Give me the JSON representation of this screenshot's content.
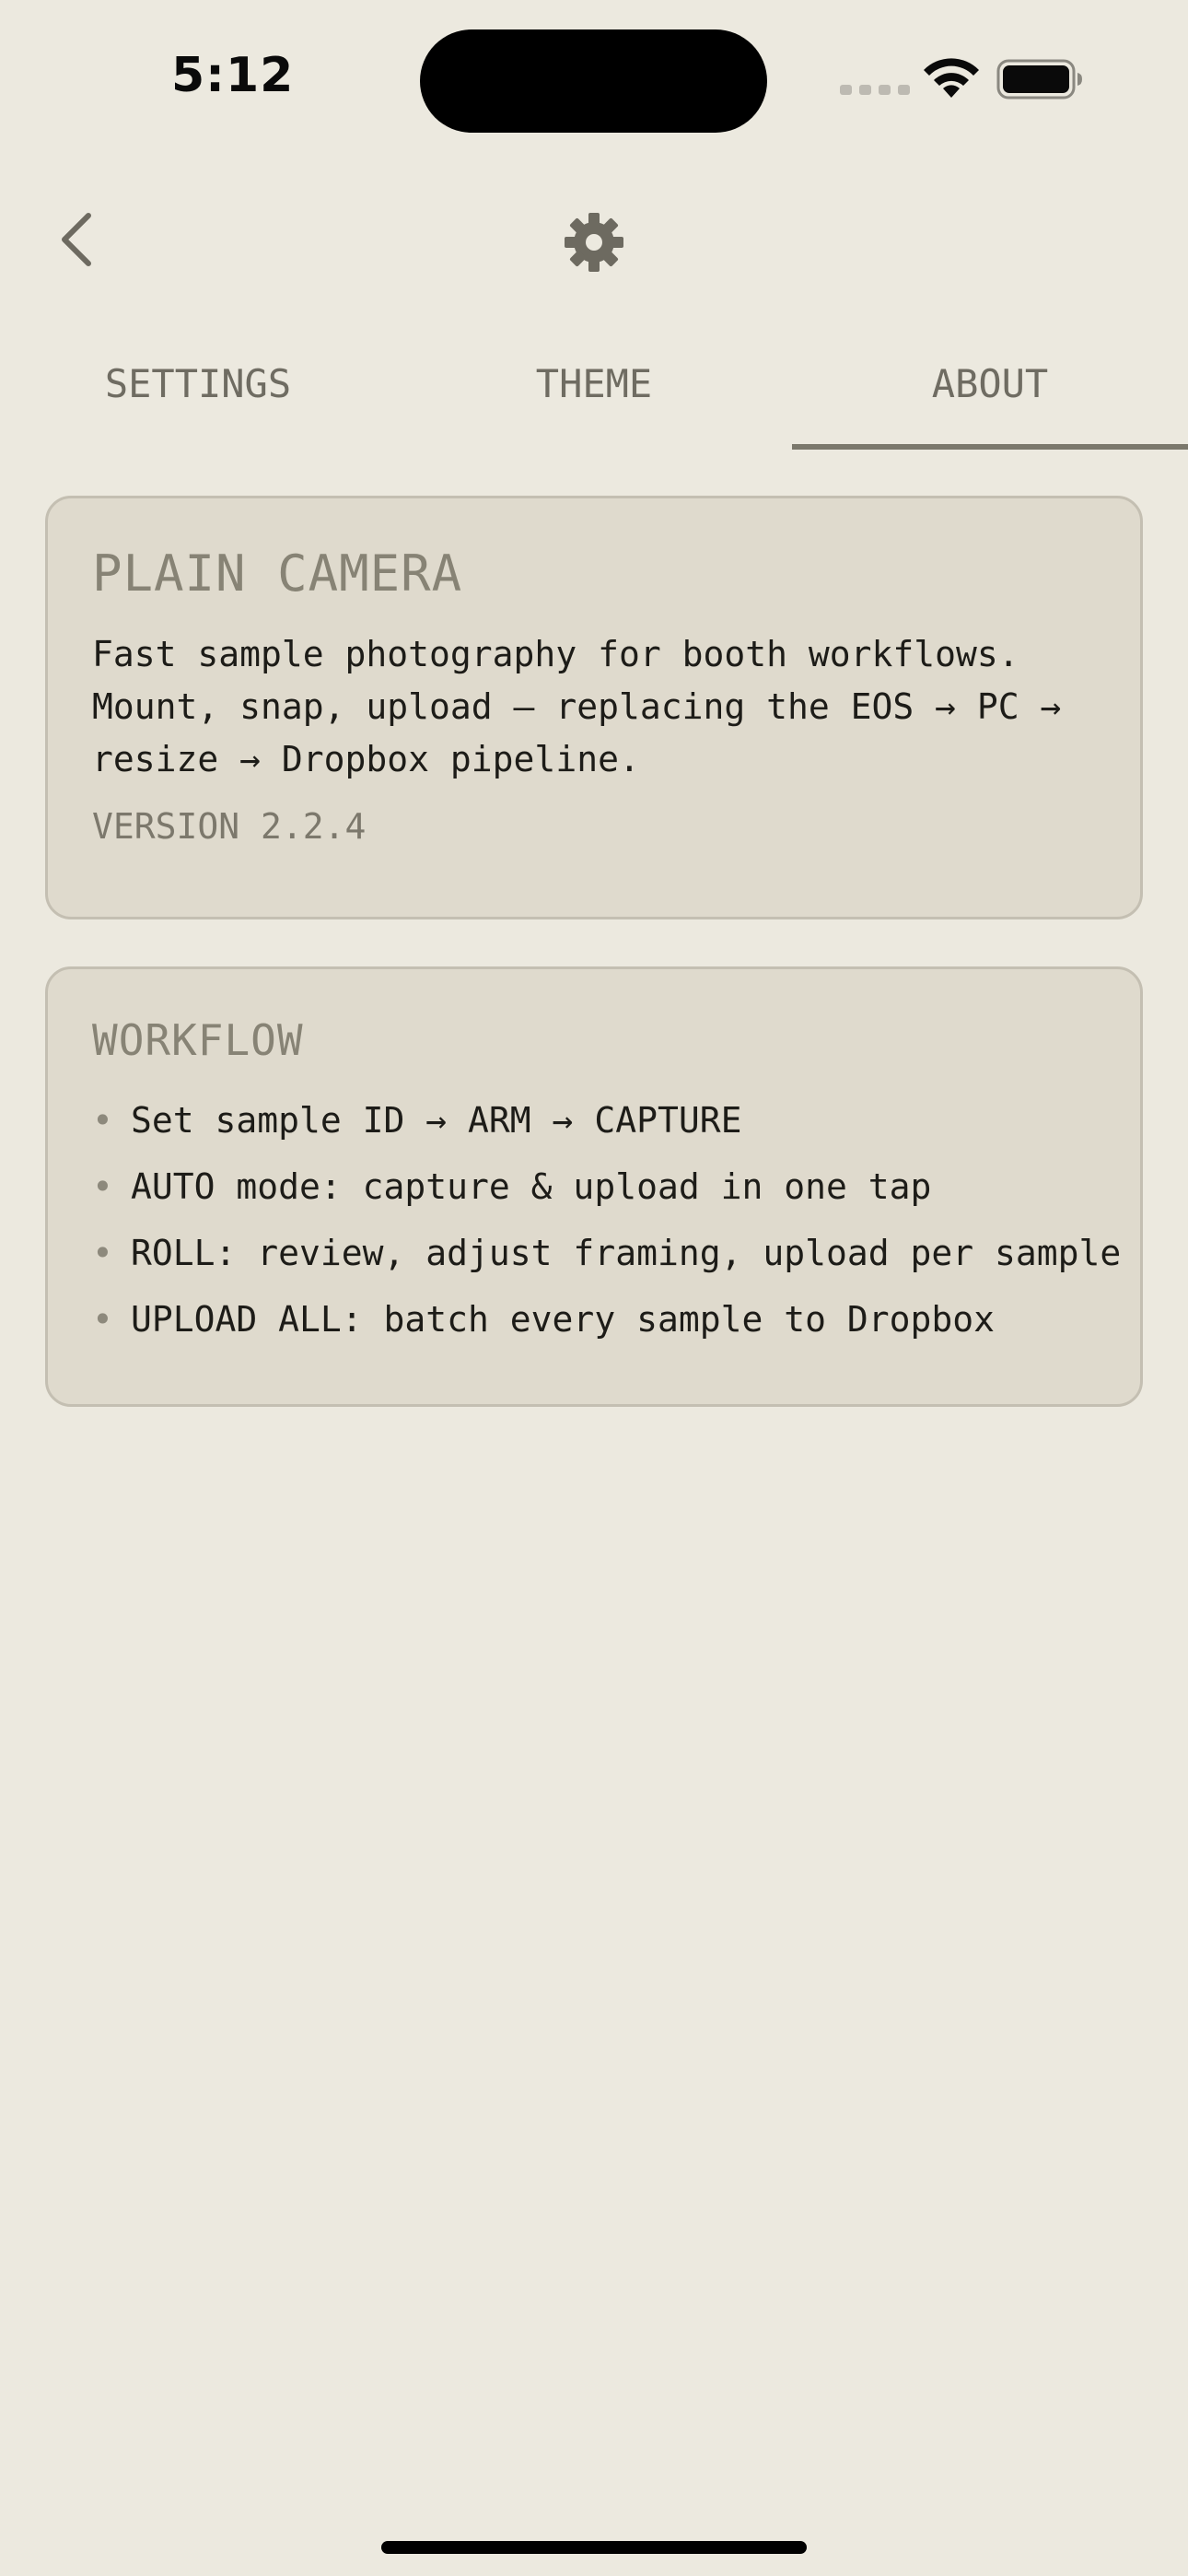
{
  "status_bar": {
    "time": "5:12"
  },
  "tabs": [
    {
      "label": "SETTINGS",
      "selected": false
    },
    {
      "label": "THEME",
      "selected": false
    },
    {
      "label": "ABOUT",
      "selected": true
    }
  ],
  "about": {
    "title": "PLAIN CAMERA",
    "description": "Fast sample photography for booth workflows. Mount, snap, upload — replacing the EOS → PC → resize → Dropbox pipeline.",
    "version": "VERSION 2.2.4"
  },
  "workflow": {
    "title": "WORKFLOW",
    "items": [
      "Set sample ID → ARM → CAPTURE",
      "AUTO mode: capture & upload in one tap",
      "ROLL: review, adjust framing, upload per sample",
      "UPLOAD ALL: batch every sample to Dropbox"
    ],
    "bullet": "•"
  },
  "icons": {
    "back": "chevron-left-icon",
    "settings": "gear-icon",
    "wifi": "wifi-icon",
    "battery": "battery-icon"
  },
  "colors": {
    "background": "#ECE9DF",
    "card": "#DFDACD",
    "accent": "#7b786c",
    "text": "#1d1c18"
  }
}
